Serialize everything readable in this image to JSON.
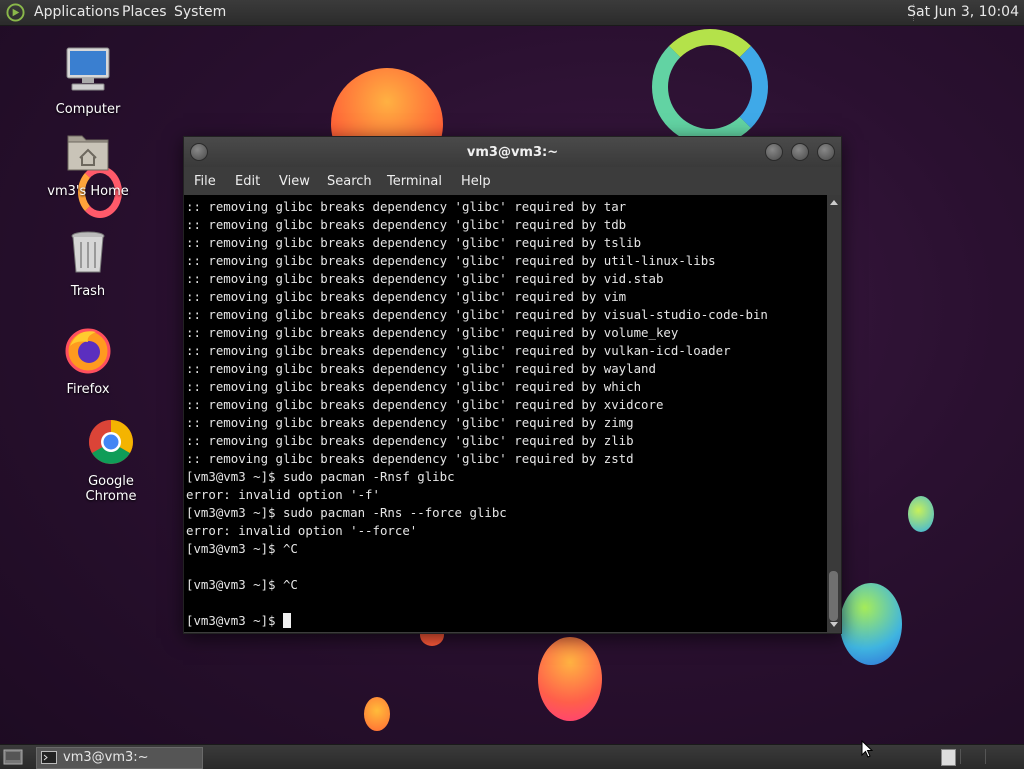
{
  "top_panel": {
    "menus": [
      "Applications",
      "Places",
      "System"
    ],
    "clock": "Sat Jun  3, 10:04"
  },
  "desktop_icons": [
    {
      "label": "Computer",
      "icon": "computer-icon"
    },
    {
      "label": "vm3's Home",
      "icon": "home-folder-icon"
    },
    {
      "label": "Trash",
      "icon": "trash-icon"
    },
    {
      "label": "Firefox",
      "icon": "firefox-icon"
    },
    {
      "label": "Google Chrome",
      "icon": "chrome-icon"
    }
  ],
  "terminal": {
    "title": "vm3@vm3:~",
    "menu": [
      "File",
      "Edit",
      "View",
      "Search",
      "Terminal",
      "Help"
    ],
    "lines": [
      ":: removing glibc breaks dependency 'glibc' required by tar",
      ":: removing glibc breaks dependency 'glibc' required by tdb",
      ":: removing glibc breaks dependency 'glibc' required by tslib",
      ":: removing glibc breaks dependency 'glibc' required by util-linux-libs",
      ":: removing glibc breaks dependency 'glibc' required by vid.stab",
      ":: removing glibc breaks dependency 'glibc' required by vim",
      ":: removing glibc breaks dependency 'glibc' required by visual-studio-code-bin",
      ":: removing glibc breaks dependency 'glibc' required by volume_key",
      ":: removing glibc breaks dependency 'glibc' required by vulkan-icd-loader",
      ":: removing glibc breaks dependency 'glibc' required by wayland",
      ":: removing glibc breaks dependency 'glibc' required by which",
      ":: removing glibc breaks dependency 'glibc' required by xvidcore",
      ":: removing glibc breaks dependency 'glibc' required by zimg",
      ":: removing glibc breaks dependency 'glibc' required by zlib",
      ":: removing glibc breaks dependency 'glibc' required by zstd",
      "[vm3@vm3 ~]$ sudo pacman -Rnsf glibc",
      "error: invalid option '-f'",
      "[vm3@vm3 ~]$ sudo pacman -Rns --force glibc",
      "error: invalid option '--force'",
      "[vm3@vm3 ~]$ ^C",
      "",
      "[vm3@vm3 ~]$ ^C",
      ""
    ],
    "prompt": "[vm3@vm3 ~]$ "
  },
  "taskbar": {
    "tasks": [
      {
        "label": "vm3@vm3:~",
        "icon": "terminal-icon"
      }
    ]
  },
  "colors": {
    "panel": "#2e2e2e",
    "terminal_bg": "#000000",
    "terminal_fg": "#e6e6e6",
    "desktop": "#2a1030"
  }
}
